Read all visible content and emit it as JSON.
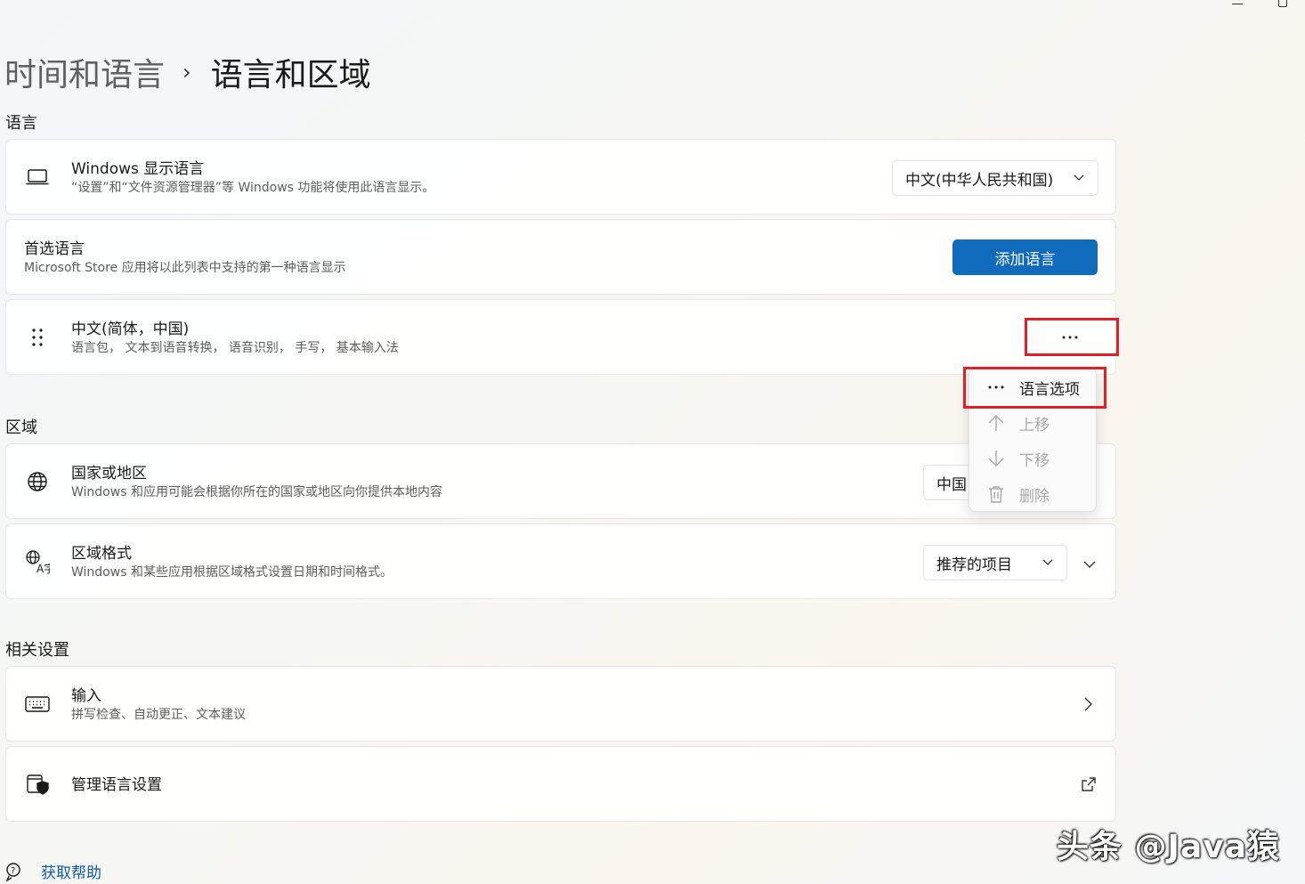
{
  "breadcrumb": {
    "parent": "时间和语言",
    "separator": "›",
    "current": "语言和区域"
  },
  "sections": {
    "language": "语言",
    "region": "区域",
    "related": "相关设置"
  },
  "display_language": {
    "title": "Windows 显示语言",
    "subtitle": "“设置”和“文件资源管理器”等 Windows 功能将使用此语言显示。",
    "selected": "中文(中华人民共和国)",
    "icon": "laptop-icon"
  },
  "preferred_language": {
    "title": "首选语言",
    "subtitle": "Microsoft Store 应用将以此列表中支持的第一种语言显示",
    "add_button": "添加语言"
  },
  "language_item": {
    "title": "中文(简体，中国)",
    "subtitle": "语言包， 文本到语音转换， 语音识别， 手写， 基本输入法",
    "more_label": "···"
  },
  "context_menu": {
    "items": [
      {
        "label": "语言选项",
        "icon": "more-horizontal-icon",
        "enabled": true
      },
      {
        "label": "上移",
        "icon": "arrow-up-icon",
        "enabled": false
      },
      {
        "label": "下移",
        "icon": "arrow-down-icon",
        "enabled": false
      },
      {
        "label": "删除",
        "icon": "trash-icon",
        "enabled": false
      }
    ]
  },
  "country": {
    "title": "国家或地区",
    "subtitle": "Windows 和应用可能会根据你所在的国家或地区向你提供本地内容",
    "selected": "中国"
  },
  "regional_format": {
    "title": "区域格式",
    "subtitle": "Windows 和某些应用根据区域格式设置日期和时间格式。",
    "selected": "推荐的项目"
  },
  "typing": {
    "title": "输入",
    "subtitle": "拼写检查、自动更正、文本建议"
  },
  "admin_language": {
    "title": "管理语言设置"
  },
  "help": {
    "label": "获取帮助"
  },
  "watermark": "头条 @Java猿",
  "colors": {
    "accent": "#0f6cbd",
    "highlight": "#e01f26"
  }
}
